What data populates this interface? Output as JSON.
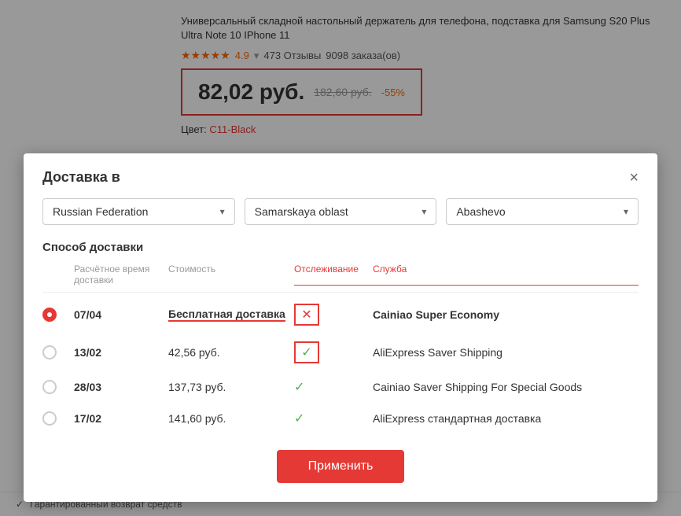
{
  "product": {
    "title": "Универсальный складной настольный держатель для телефона, подставка для Samsung S20 Plus Ultra Note 10 IPhone 11",
    "rating_stars": "★★★★★",
    "rating_value": "4.9",
    "rating_arrow": "▾",
    "reviews_label": "473 Отзывы",
    "orders_label": "9098 заказа(ов)",
    "price_main": "82,02 руб.",
    "price_old": "182,60 руб.",
    "price_discount": "-55%",
    "color_label": "Цвет:",
    "color_value": "C11-Black"
  },
  "modal": {
    "title": "Доставка в",
    "close_label": "×",
    "country": "Russian Federation",
    "region": "Samarskaya oblast",
    "city": "Abashevo",
    "dropdown_arrow": "▾",
    "delivery_method_label": "Способ доставки",
    "col_delivery_time": "Расчётное время доставки",
    "col_cost": "Стоимость",
    "col_tracking": "Отслеживание",
    "col_service": "Служба",
    "rows": [
      {
        "selected": true,
        "date": "07/04",
        "cost": "Бесплатная доставка",
        "cost_free": true,
        "tracking": "cross",
        "service": "Cainiao Super Economy",
        "service_bold": true
      },
      {
        "selected": false,
        "date": "13/02",
        "cost": "42,56 руб.",
        "cost_free": false,
        "tracking": "check_box",
        "service": "AliExpress Saver Shipping",
        "service_bold": false
      },
      {
        "selected": false,
        "date": "28/03",
        "cost": "137,73 руб.",
        "cost_free": false,
        "tracking": "check",
        "service": "Cainiao Saver Shipping For Special Goods",
        "service_bold": false
      },
      {
        "selected": false,
        "date": "17/02",
        "cost": "141,60 руб.",
        "cost_free": false,
        "tracking": "check",
        "service": "AliExpress стандартная доставка",
        "service_bold": false
      }
    ],
    "apply_button": "Применить"
  },
  "bottom": {
    "hint": "Гарантированный возврат средств"
  }
}
